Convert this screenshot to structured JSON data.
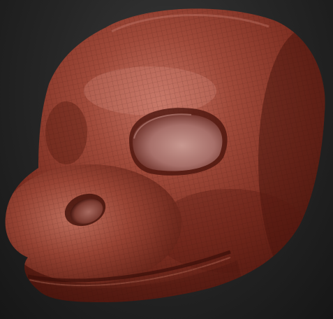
{
  "viewport": {
    "background_color": "#262626",
    "model": {
      "material_base_color": "#8a3a2c",
      "material_highlight_color": "#c57a68",
      "material_shadow_color": "#4a1a12",
      "wireframe_visible": true
    }
  }
}
